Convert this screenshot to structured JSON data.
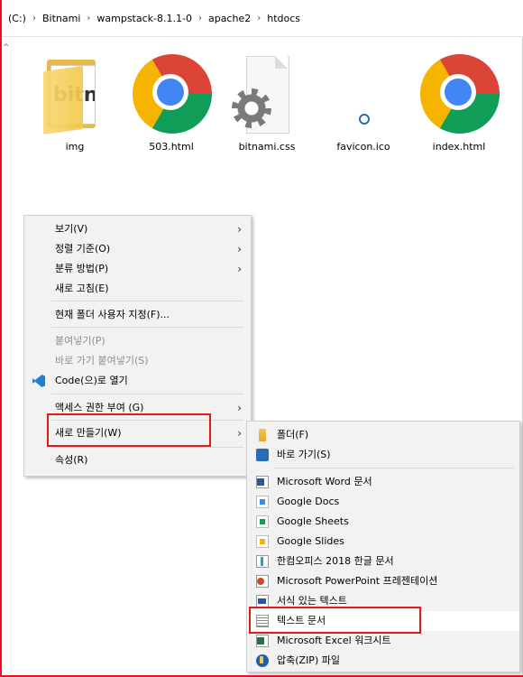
{
  "address_bar": {
    "crumbs": [
      "(C:)",
      "Bitnami",
      "wampstack-8.1.1-0",
      "apache2",
      "htdocs"
    ]
  },
  "files": [
    {
      "name": "img",
      "icon": "folder-icon"
    },
    {
      "name": "503.html",
      "icon": "chrome-icon"
    },
    {
      "name": "bitnami.css",
      "icon": "css-file-icon"
    },
    {
      "name": "favicon.ico",
      "icon": "ico-file-icon"
    },
    {
      "name": "index.html",
      "icon": "chrome-icon"
    }
  ],
  "folder_preview_text": "bitn",
  "context_menu": {
    "items": [
      {
        "label": "보기(V)",
        "submenu": true
      },
      {
        "label": "정렬 기준(O)",
        "submenu": true
      },
      {
        "label": "분류 방법(P)",
        "submenu": true
      },
      {
        "label": "새로 고침(E)"
      },
      {
        "label": "현재 폴더 사용자 지정(F)..."
      },
      {
        "label": "붙여넣기(P)",
        "disabled": true
      },
      {
        "label": "바로 가기 붙여넣기(S)",
        "disabled": true
      },
      {
        "label": "Code(으)로 열기",
        "icon": "vscode-icon"
      },
      {
        "label": "액세스 권한 부여 (G)",
        "submenu": true
      },
      {
        "label": "새로 만들기(W)",
        "submenu": true
      },
      {
        "label": "속성(R)"
      }
    ],
    "arrow": "›"
  },
  "new_submenu": {
    "items": [
      {
        "label": "폴더(F)",
        "icon": "folder-icon"
      },
      {
        "label": "바로 가기(S)",
        "icon": "shortcut-icon"
      },
      {
        "label": "Microsoft Word 문서",
        "icon": "word-icon"
      },
      {
        "label": "Google Docs",
        "icon": "google-docs-icon"
      },
      {
        "label": "Google Sheets",
        "icon": "google-sheets-icon"
      },
      {
        "label": "Google Slides",
        "icon": "google-slides-icon"
      },
      {
        "label": "한컴오피스 2018 한글 문서",
        "icon": "hwp-icon"
      },
      {
        "label": "Microsoft PowerPoint 프레젠테이션",
        "icon": "powerpoint-icon"
      },
      {
        "label": "서식 있는 텍스트",
        "icon": "wordpad-icon"
      },
      {
        "label": "텍스트 문서",
        "icon": "text-document-icon"
      },
      {
        "label": "Microsoft Excel 워크시트",
        "icon": "excel-icon"
      },
      {
        "label": "압축(ZIP) 파일",
        "icon": "zip-icon"
      }
    ]
  },
  "colors": {
    "highlight": "#e01b1b",
    "menu_bg": "#f2f2f2",
    "window_border": "#e81123"
  }
}
